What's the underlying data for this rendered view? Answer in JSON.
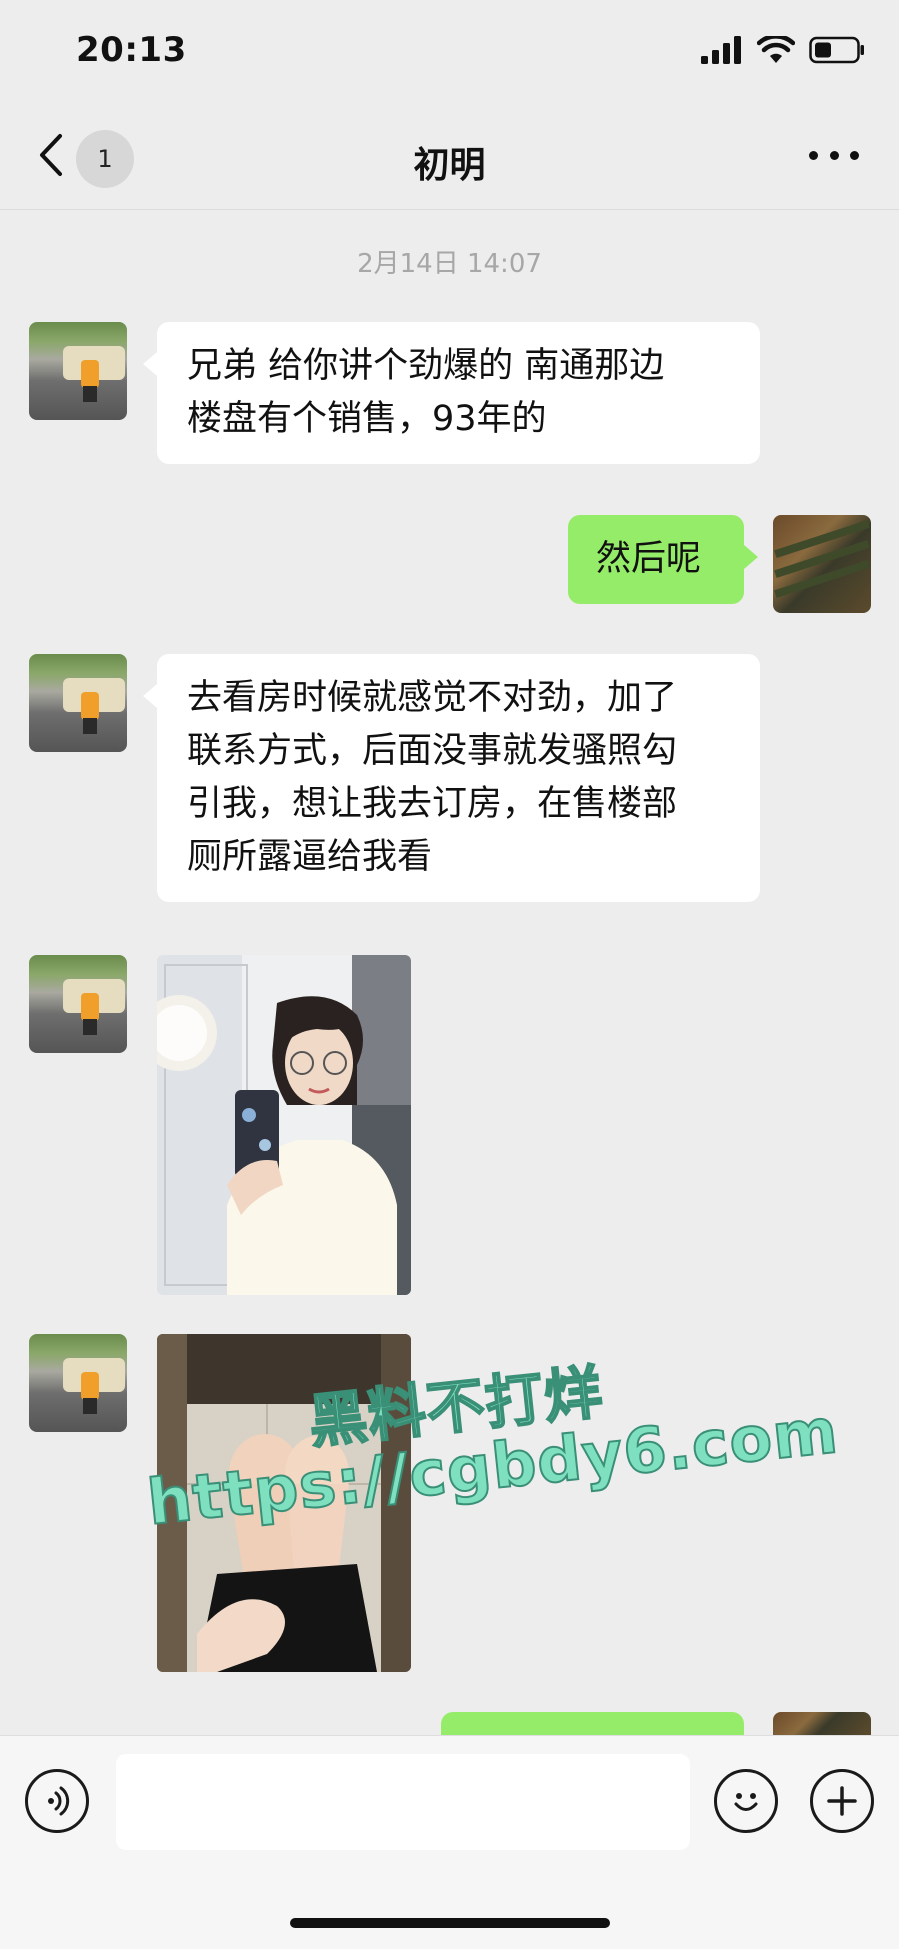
{
  "status_bar": {
    "time": "20:13"
  },
  "nav": {
    "unread_count": "1",
    "title": "初明"
  },
  "timestamp": "2月14日 14:07",
  "messages": [
    {
      "side": "left",
      "type": "text",
      "text": "兄弟 给你讲个劲爆的 南通那边\n楼盘有个销售，93年的"
    },
    {
      "side": "right",
      "type": "text",
      "text": "然后呢"
    },
    {
      "side": "left",
      "type": "text",
      "text": "去看房时候就感觉不对劲，加了\n联系方式，后面没事就发骚照勾\n引我，想让我去订房，在售楼部\n厕所露逼给我看"
    },
    {
      "side": "left",
      "type": "image",
      "icon": "selfie-photo"
    },
    {
      "side": "left",
      "type": "image",
      "icon": "legs-photo"
    }
  ],
  "watermark": {
    "line1": "黑料不打烊",
    "line2": "https://cgbdy6.com"
  },
  "colors": {
    "background": "#ededed",
    "bubble_self": "#95ec69",
    "bubble_other": "#ffffff",
    "watermark": "#7fe0c0"
  }
}
